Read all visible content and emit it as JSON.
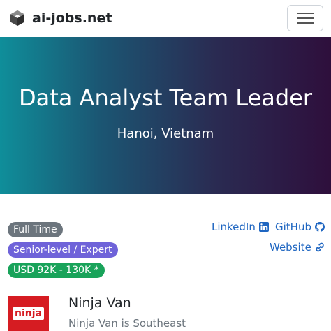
{
  "navbar": {
    "brand": "ai-jobs.net",
    "brand_icon": "cube-logo-icon",
    "menu_icon": "hamburger-menu-icon"
  },
  "hero": {
    "title": "Data Analyst Team Leader",
    "location": "Hanoi, Vietnam",
    "gradient": [
      "#0f8e9a",
      "#2e0f3c"
    ]
  },
  "badges": {
    "type": "Full Time",
    "level": "Senior-level / Expert",
    "salary": "USD 92K - 130K *"
  },
  "links": {
    "linkedin": "LinkedIn",
    "github": "GitHub",
    "website": "Website"
  },
  "company": {
    "name": "Ninja Van",
    "description": "Ninja Van is Southeast",
    "logo_text": "ninja",
    "logo_color": "#d61c22"
  },
  "colors": {
    "link": "#1f66c1",
    "badge_type": "#6c757d",
    "badge_level": "#6f63d9",
    "badge_salary": "#19a35a"
  }
}
